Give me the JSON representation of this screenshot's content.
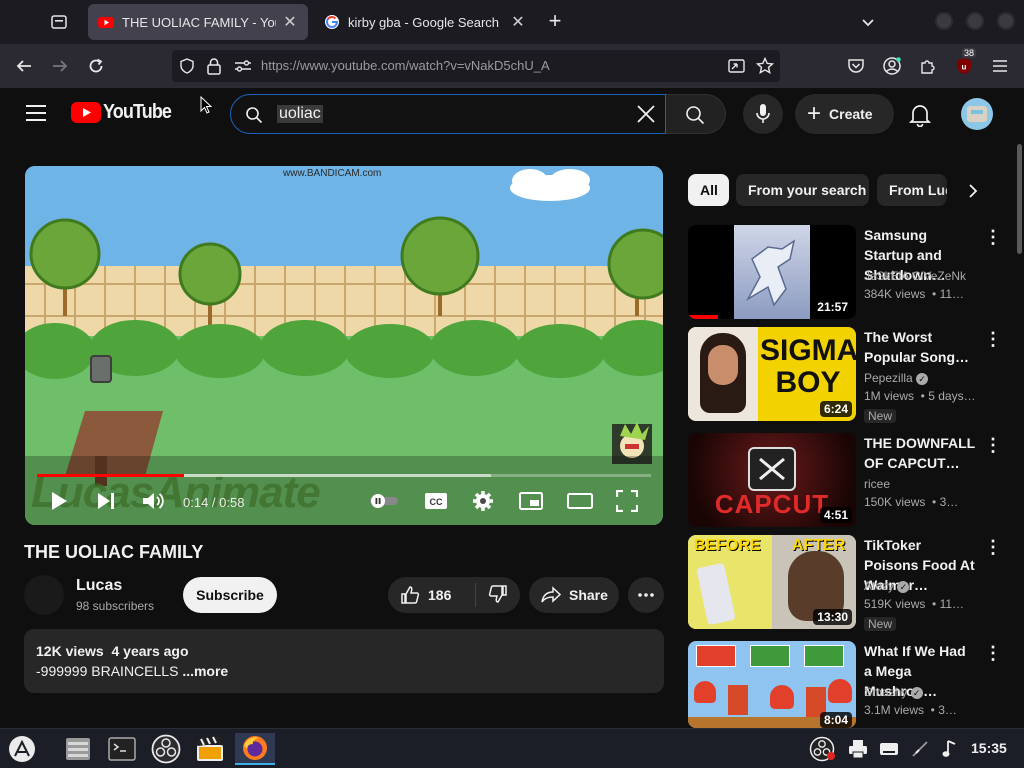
{
  "browser": {
    "tabs": [
      {
        "title": "THE UOLIAC FAMILY - YouTub",
        "close": "✕"
      },
      {
        "title": "kirby gba - Google Search",
        "close": "✕"
      }
    ],
    "new_tab": "+",
    "url": "https://www.youtube.com/watch?v=vNakD5chU_A",
    "extension_badge": "38"
  },
  "youtube": {
    "logo_text": "YouTube",
    "search_query": "uoliac",
    "create_label": "Create",
    "player": {
      "watermark_top": "www.BANDICAM.com",
      "watermark_bottom": "LucasAnimate",
      "time": "0:14 / 0:58",
      "progress": 0.24,
      "buffered": 0.74
    },
    "video": {
      "title": "THE UOLIAC FAMILY",
      "channel": "Lucas",
      "subscribers": "98 subscribers",
      "subscribe_label": "Subscribe",
      "likes": "186",
      "share_label": "Share",
      "views_date": "12K views  4 years ago",
      "description": "-999999 BRAINCELLS",
      "more_label": "...more"
    },
    "chips": [
      "All",
      "From your search",
      "From Lucas"
    ],
    "recommendations": [
      {
        "title": "Samsung Startup and Shutdown…",
        "channel": "JeSkElA CiVeZeNk",
        "meta": "384K views  • 11…",
        "duration": "21:57",
        "badge": ""
      },
      {
        "title": "The Worst Popular Song…",
        "channel": "Pepezilla",
        "meta": "1M views  • 5 days…",
        "duration": "6:24",
        "badge": "New",
        "thumb_text": "SIGMA BOY"
      },
      {
        "title": "THE DOWNFALL OF CAPCUT…",
        "channel": "ricee",
        "meta": "150K views  • 3…",
        "duration": "4:51",
        "badge": "",
        "thumb_text": "CAPCUT"
      },
      {
        "title": "TikToker Poisons Food At Walmar…",
        "channel": "Atozy",
        "meta": "519K views  • 11…",
        "duration": "13:30",
        "badge": "New",
        "thumb_text_a": "BEFORE",
        "thumb_text_b": "AFTER"
      },
      {
        "title": "What If We Had a Mega Mushroo…",
        "channel": "Smashy",
        "meta": "3.1M views  • 3…",
        "duration": "8:04",
        "badge": ""
      }
    ]
  },
  "taskbar": {
    "clock": "15:35"
  },
  "colors": {
    "yt_red": "#ff0000",
    "progress_red": "#ff0000",
    "search_focus": "#1c62b9"
  }
}
